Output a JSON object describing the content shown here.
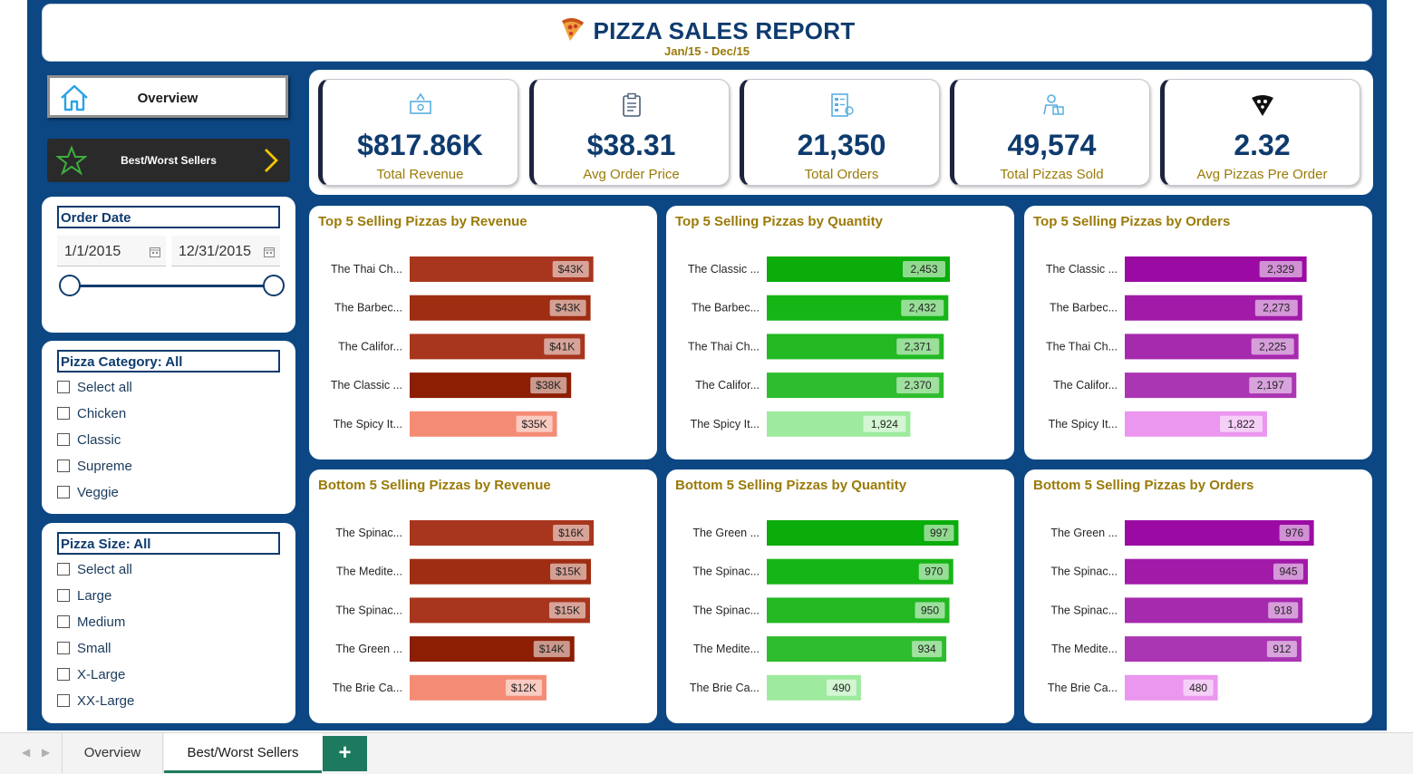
{
  "header": {
    "title": "PIZZA SALES REPORT",
    "subtitle": "Jan/15 - Dec/15",
    "title_icon": "pizza-icon"
  },
  "nav": {
    "overview_label": "Overview",
    "overview_icon": "home-icon",
    "best_worst_label": "Best/Worst Sellers",
    "best_worst_icon": "star-icon"
  },
  "order_date": {
    "title": "Order Date",
    "start": "1/1/2015",
    "end": "12/31/2015"
  },
  "pizza_category": {
    "title": "Pizza Category: All",
    "options": [
      "Select all",
      "Chicken",
      "Classic",
      "Supreme",
      "Veggie"
    ]
  },
  "pizza_size": {
    "title": "Pizza Size: All",
    "options": [
      "Select all",
      "Large",
      "Medium",
      "Small",
      "X-Large",
      "XX-Large"
    ]
  },
  "kpis": [
    {
      "value": "$817.86K",
      "label": "Total Revenue",
      "icon": "money-icon"
    },
    {
      "value": "$38.31",
      "label": "Avg Order Price",
      "icon": "clipboard-icon"
    },
    {
      "value": "21,350",
      "label": "Total Orders",
      "icon": "order-list-icon"
    },
    {
      "value": "49,574",
      "label": "Total Pizzas Sold",
      "icon": "delivery-icon"
    },
    {
      "value": "2.32",
      "label": "Avg Pizzas Pre Order",
      "icon": "pizza-slice-icon"
    }
  ],
  "colors": {
    "revenue": [
      "#a8361e",
      "#9f2d12",
      "#a8361e",
      "#8c1e04",
      "#f48c75"
    ],
    "quantity": [
      "#0aad0a",
      "#16b516",
      "#22b922",
      "#2ebd2e",
      "#9eea9e"
    ],
    "orders": [
      "#9b0ba3",
      "#a11aa8",
      "#a62aae",
      "#ab36b3",
      "#eb96ef"
    ],
    "title_gold": "#9a7a08",
    "navy": "#0c4783"
  },
  "chart_data": [
    {
      "type": "bar",
      "title": "Top 5 Selling Pizzas by Revenue",
      "categories": [
        "The Thai Ch...",
        "The Barbec...",
        "The Califor...",
        "The Classic ...",
        "The Spicy It..."
      ],
      "values": [
        43434,
        42768,
        41410,
        38180,
        34831
      ],
      "labels": [
        "$43K",
        "$43K",
        "$41K",
        "$38K",
        "$35K"
      ],
      "xlim": [
        0,
        60000
      ],
      "palette": "revenue"
    },
    {
      "type": "bar",
      "title": "Top 5 Selling Pizzas by Quantity",
      "categories": [
        "The Classic ...",
        "The Barbec...",
        "The Thai Ch...",
        "The Califor...",
        "The Spicy It..."
      ],
      "values": [
        2453,
        2432,
        2371,
        2370,
        1924
      ],
      "labels": [
        "2,453",
        "2,432",
        "2,371",
        "2,370",
        "1,924"
      ],
      "xlim": [
        0,
        3400
      ],
      "palette": "quantity"
    },
    {
      "type": "bar",
      "title": "Top 5 Selling Pizzas by Orders",
      "categories": [
        "The Classic ...",
        "The Barbec...",
        "The Thai Ch...",
        "The Califor...",
        "The Spicy It..."
      ],
      "values": [
        2329,
        2273,
        2225,
        2197,
        1822
      ],
      "labels": [
        "2,329",
        "2,273",
        "2,225",
        "2,197",
        "1,822"
      ],
      "xlim": [
        0,
        3250
      ],
      "palette": "orders"
    },
    {
      "type": "bar",
      "title": "Bottom 5 Selling Pizzas by Revenue",
      "categories": [
        "The Spinac...",
        "The Medite...",
        "The Spinac...",
        "The Green ...",
        "The Brie Ca..."
      ],
      "values": [
        15596,
        15360,
        15278,
        13956,
        11588
      ],
      "labels": [
        "$16K",
        "$15K",
        "$15K",
        "$14K",
        "$12K"
      ],
      "xlim": [
        0,
        21500
      ],
      "palette": "revenue"
    },
    {
      "type": "bar",
      "title": "Bottom 5 Selling Pizzas by Quantity",
      "categories": [
        "The Green ...",
        "The Spinac...",
        "The Spinac...",
        "The Medite...",
        "The Brie Ca..."
      ],
      "values": [
        997,
        970,
        950,
        934,
        490
      ],
      "labels": [
        "997",
        "970",
        "950",
        "934",
        "490"
      ],
      "xlim": [
        0,
        1320
      ],
      "palette": "quantity"
    },
    {
      "type": "bar",
      "title": "Bottom 5 Selling Pizzas by Orders",
      "categories": [
        "The Green ...",
        "The Spinac...",
        "The Spinac...",
        "The Medite...",
        "The Brie Ca..."
      ],
      "values": [
        976,
        945,
        918,
        912,
        480
      ],
      "labels": [
        "976",
        "945",
        "918",
        "912",
        "480"
      ],
      "xlim": [
        0,
        1310
      ],
      "palette": "orders"
    }
  ],
  "tabs": {
    "overview": "Overview",
    "best_worst": "Best/Worst Sellers",
    "add": "+"
  }
}
